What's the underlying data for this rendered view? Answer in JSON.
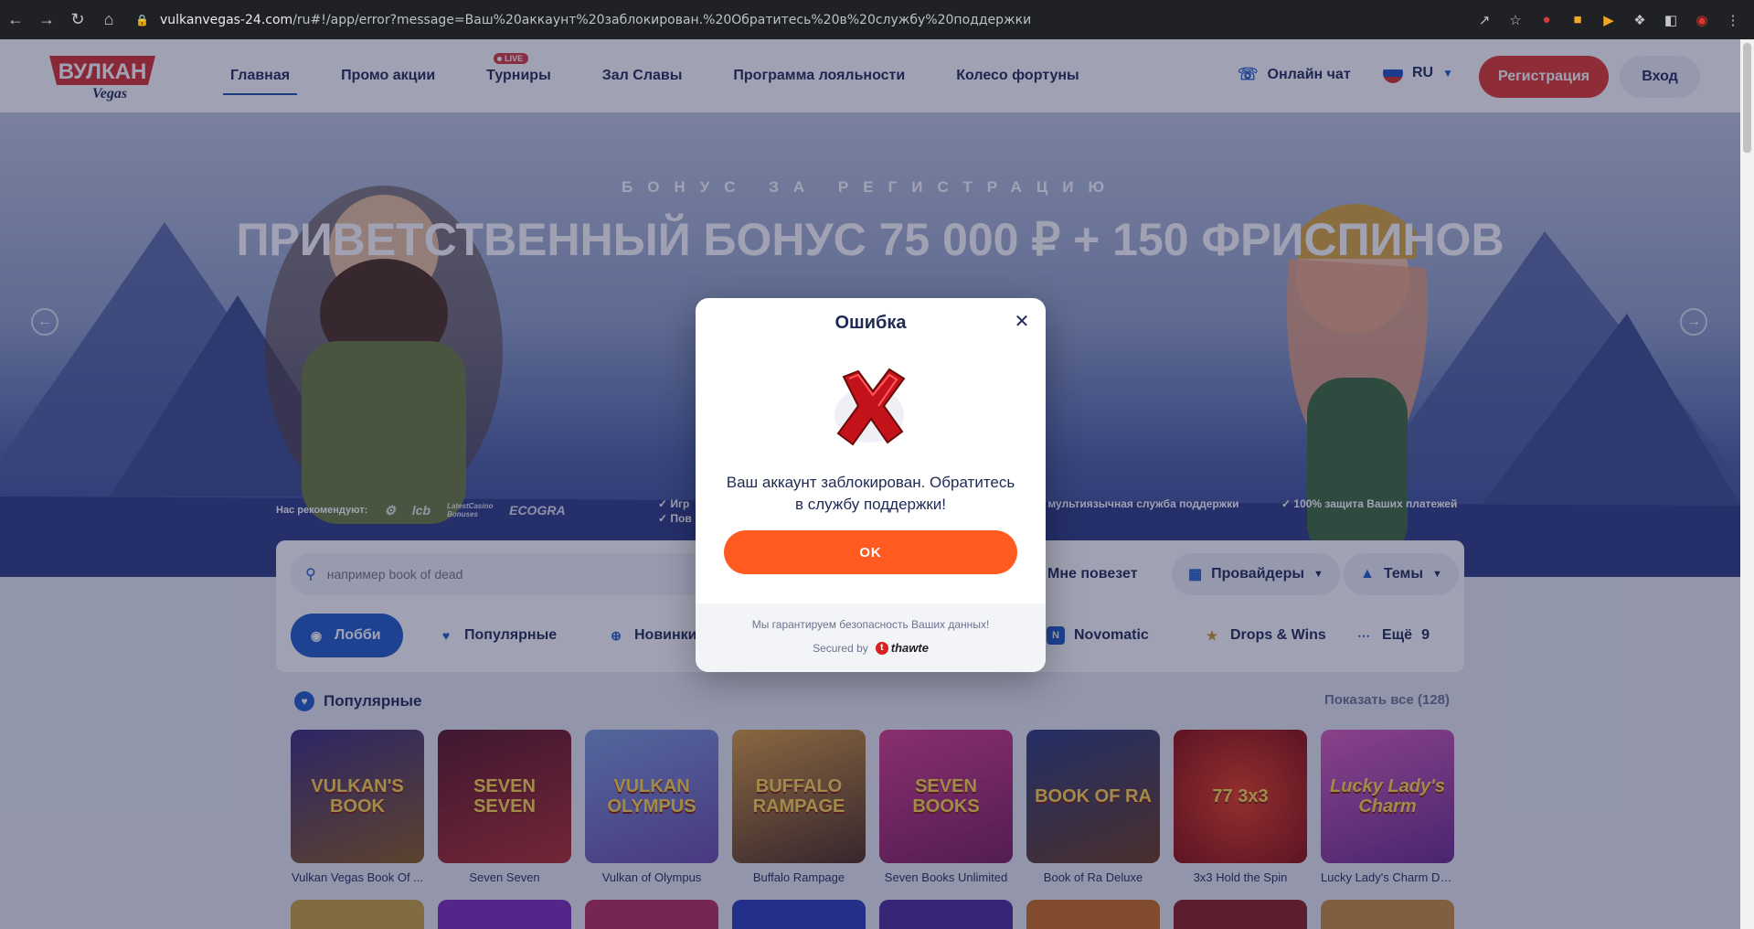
{
  "browser": {
    "url_host": "vulkanvegas-24.com",
    "url_path": "/ru#!/app/error?message=Ваш%20аккаунт%20заблокирован.%20Обратитесь%20в%20службу%20поддержки"
  },
  "header": {
    "logo_top": "ВУЛКАН",
    "logo_bottom": "Vegas",
    "nav": [
      {
        "label": "Главная",
        "active": true
      },
      {
        "label": "Промо акции"
      },
      {
        "label": "Турниры",
        "badge": "LIVE"
      },
      {
        "label": "Зал Славы"
      },
      {
        "label": "Программа лояльности"
      },
      {
        "label": "Колесо фортуны"
      }
    ],
    "chat_label": "Онлайн чат",
    "lang": "RU",
    "register_label": "Регистрация",
    "login_label": "Вход"
  },
  "hero": {
    "subtitle": "БОНУС ЗА РЕГИСТРАЦИЮ",
    "title": "ПРИВЕТСТВЕННЫЙ БОНУС 75 000 ₽ + 150 ФРИСПИНОВ",
    "recommend_label": "Нас рекомендуют:",
    "rec_logos": [
      "lcb",
      "LatestCasino Bonuses",
      "ECOGRA"
    ],
    "features_left": [
      "Игр",
      "Пов"
    ],
    "feature_mid": "я мультиязычная служба поддержки",
    "feature_right": "100% защита Ваших платежей"
  },
  "filters": {
    "search_placeholder": "например book of dead",
    "lucky_label": "Мне повезет",
    "providers_label": "Провайдеры",
    "themes_label": "Темы",
    "categories": [
      {
        "label": "Лобби",
        "active": true
      },
      {
        "label": "Популярные"
      },
      {
        "label": "Новинки"
      },
      {
        "label": "Novomatic"
      },
      {
        "label": "Drops & Wins"
      },
      {
        "label": "Ещё",
        "count": "9"
      }
    ]
  },
  "section": {
    "title": "Популярные",
    "show_all": "Показать все (128)"
  },
  "games": [
    {
      "name": "Vulkan Vegas Book Of ...",
      "art": "VULKAN'S BOOK"
    },
    {
      "name": "Seven Seven",
      "art": "SEVEN SEVEN"
    },
    {
      "name": "Vulkan of Olympus",
      "art": "VULKAN OLYMPUS"
    },
    {
      "name": "Buffalo Rampage",
      "art": "BUFFALO RAMPAGE"
    },
    {
      "name": "Seven Books Unlimited",
      "art": "SEVEN BOOKS"
    },
    {
      "name": "Book of Ra Deluxe",
      "art": "BOOK OF RA"
    },
    {
      "name": "3x3 Hold the Spin",
      "art": "77 3x3"
    },
    {
      "name": "Lucky Lady's Charm De...",
      "art": "Lucky Lady's Charm"
    }
  ],
  "modal": {
    "title": "Ошибка",
    "message": "Ваш аккаунт заблокирован. Обратитесь в службу поддержки!",
    "ok_label": "OK",
    "guarantee": "Мы гарантируем безопасность Ваших данных!",
    "secured_by": "Secured by",
    "secured_brand": "thawte"
  },
  "colors": {
    "accent_red": "#e0342a",
    "accent_orange": "#ff5a1f",
    "accent_blue": "#1f5bc7",
    "text_navy": "#1f2a55"
  }
}
